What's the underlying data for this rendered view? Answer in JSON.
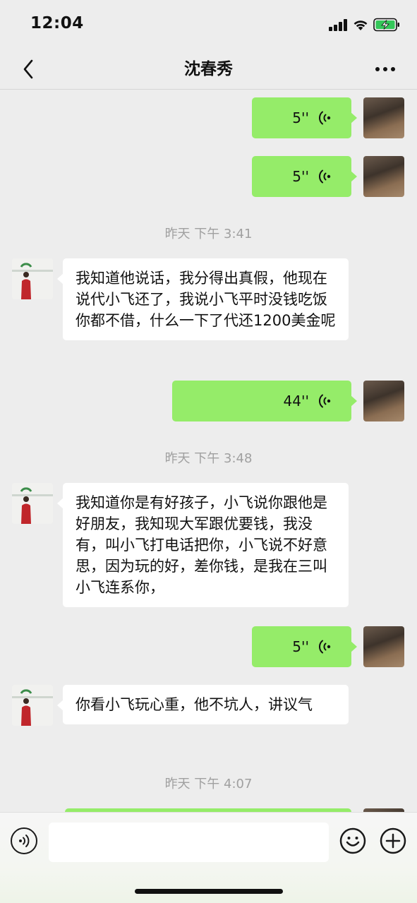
{
  "status": {
    "time": "12:04"
  },
  "header": {
    "title": "沈春秀"
  },
  "messages": [
    {
      "kind": "voice",
      "sender": "me",
      "duration": "5''"
    },
    {
      "kind": "voice",
      "sender": "me",
      "duration": "5''"
    },
    {
      "kind": "timestamp",
      "text": "昨天 下午 3:41"
    },
    {
      "kind": "text",
      "sender": "other",
      "text": "我知道他说话，我分得出真假，他现在说代小飞还了，我说小飞平时没钱吃饭你都不借，什么一下了代还1200美金呢"
    },
    {
      "kind": "voice",
      "sender": "me",
      "duration": "44''"
    },
    {
      "kind": "timestamp",
      "text": "昨天 下午 3:48"
    },
    {
      "kind": "text",
      "sender": "other",
      "text": "我知道你是有好孩子，小飞说你跟他是好朋友，我知现大军跟优要钱，我没有，叫小飞打电话把你，小飞说不好意思，因为玩的好，差你钱，是我在三叫小飞连系你，"
    },
    {
      "kind": "voice",
      "sender": "me",
      "duration": "5''"
    },
    {
      "kind": "text",
      "sender": "other",
      "text": "你看小飞玩心重，他不坑人，讲议气"
    },
    {
      "kind": "timestamp",
      "text": "昨天 下午 4:07"
    }
  ],
  "input": {
    "placeholder": ""
  },
  "icons": {
    "back": "chevron-left-icon",
    "more": "more-dots-icon",
    "voice_toggle": "voice-icon",
    "emoji": "emoji-icon",
    "plus": "plus-icon"
  },
  "colors": {
    "sent_bubble": "#95ec69",
    "received_bubble": "#ffffff",
    "background": "#ededed",
    "timestamp": "#a0a0a0"
  }
}
